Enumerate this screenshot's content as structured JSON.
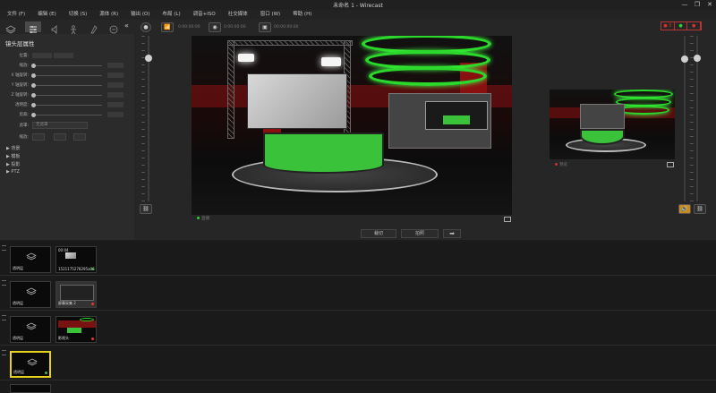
{
  "window": {
    "title": "未命名 1 - Wirecast",
    "controls": [
      "—",
      "❐",
      "✕"
    ]
  },
  "menu": [
    "文件 (F)",
    "编辑 (E)",
    "切换 (S)",
    "源体 (R)",
    "输出 (O)",
    "布局 (L)",
    "调音+ISO",
    "社交媒体",
    "窗口 (W)",
    "帮助 (H)"
  ],
  "left_panel": {
    "title": "镜头层属性",
    "properties": [
      {
        "label": "位置:"
      },
      {
        "label": "缩放:"
      },
      {
        "label": "X 轴旋转:"
      },
      {
        "label": "Y 轴旋转:"
      },
      {
        "label": "Z 轴旋转:"
      },
      {
        "label": "透明度:"
      },
      {
        "label": "剪裁:"
      }
    ],
    "mask_label": "遮罩:",
    "mask_value": "无遮罩",
    "scale_label": "缩放:",
    "tree": [
      "▶ 背景",
      "▶ 模板",
      "▶ 投影",
      "▶ PTZ"
    ]
  },
  "preview": {
    "live_label": "0:00:00:00",
    "stream_label": "00:00:00:00",
    "program_label": "预览",
    "live_status": "直播"
  },
  "mid_controls": {
    "transition1": "裁切",
    "transition2": "拍照",
    "go": "➡"
  },
  "rec_indicators": [
    "● 0",
    "●",
    "●"
  ],
  "layers": [
    {
      "shots": [
        {
          "label": "透明层",
          "icon": "layers-icon",
          "selected": false
        },
        {
          "label": "1521175278295a06",
          "time": "00:04",
          "type": "image",
          "dot": "#4caf50",
          "selected": false
        }
      ]
    },
    {
      "shots": [
        {
          "label": "透明层",
          "icon": "layers-icon",
          "selected": false
        },
        {
          "label": "屏幕采集 2",
          "type": "screen",
          "dot": "#e53935",
          "selected": false
        }
      ]
    },
    {
      "shots": [
        {
          "label": "透明层",
          "icon": "layers-icon",
          "selected": false
        },
        {
          "label": "影视头",
          "type": "studio",
          "dot": "#e53935",
          "selected": false
        }
      ]
    },
    {
      "shots": [
        {
          "label": "透明层",
          "icon": "layers-icon",
          "selected": true,
          "dot": "#4caf50"
        }
      ]
    }
  ],
  "colors": {
    "accent_green": "#2bd82b",
    "selection": "#e6d219",
    "live_red": "#b33"
  }
}
